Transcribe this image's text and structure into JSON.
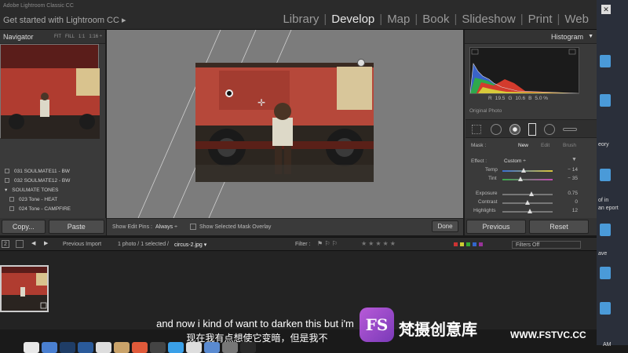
{
  "app": {
    "brand_line1": "Adobe Lightroom Classic CC",
    "brand_line2": "Get started with Lightroom CC ▸"
  },
  "modules": [
    "Library",
    "Develop",
    "Map",
    "Book",
    "Slideshow",
    "Print",
    "Web"
  ],
  "active_module": "Develop",
  "navigator": {
    "title": "Navigator",
    "zoom": [
      "FIT",
      "FILL",
      "1:1",
      "1:16 ÷"
    ]
  },
  "presets": [
    "031 SOULMATE11 - BW",
    "032 SOULMATE12 - BW",
    "SOULMATE TONES",
    "023 Tone - HEAT",
    "024 Tone - CAMPFIRE"
  ],
  "left_buttons": {
    "copy": "Copy...",
    "paste": "Paste"
  },
  "center_toolbar": {
    "pins_label": "Show Edit Pins :",
    "pins_value": "Always ÷",
    "mask_overlay": "Show Selected Mask Overlay",
    "done": "Done"
  },
  "histogram": {
    "title": "Histogram",
    "r_label": "R",
    "r": "19.5",
    "g_label": "G",
    "g": "10.6",
    "b_label": "B",
    "b": "5.0 %",
    "original": "Original Photo"
  },
  "mask": {
    "label": "Mask :",
    "new": "New",
    "edit": "Edit",
    "brush": "Brush"
  },
  "effect": {
    "label": "Effect :",
    "value": "Custom ÷"
  },
  "sliders": [
    {
      "name": "Temp",
      "value": "− 14",
      "level": 0.42
    },
    {
      "name": "Tint",
      "value": "− 35",
      "level": 0.36
    },
    {
      "name": "Exposure",
      "value": "0.75",
      "level": 0.58
    },
    {
      "name": "Contrast",
      "value": "0",
      "level": 0.5
    },
    {
      "name": "Highlights",
      "value": "12",
      "level": 0.55
    }
  ],
  "right_buttons": {
    "previous": "Previous",
    "reset": "Reset"
  },
  "filmbar": {
    "page": "2",
    "previous_import": "Previous Import",
    "photo_count": "1 photo / 1 selected /",
    "filename": "circus-2.jpg ▾",
    "filter_label": "Filter :",
    "filters_off": "Filters Off"
  },
  "desktop_side": {
    "line1": "eory",
    "line2": "of in",
    "line3": "an eport",
    "line4": "ave",
    "line5": "AM"
  },
  "subtitles": {
    "en": "and now i kind of want to darken this but i'm",
    "zh": "现在我有点想使它变暗，但是我不"
  },
  "watermark": {
    "logo": "FS",
    "name": "梵摄创意库",
    "url": "WWW.FSTVC.CC"
  }
}
